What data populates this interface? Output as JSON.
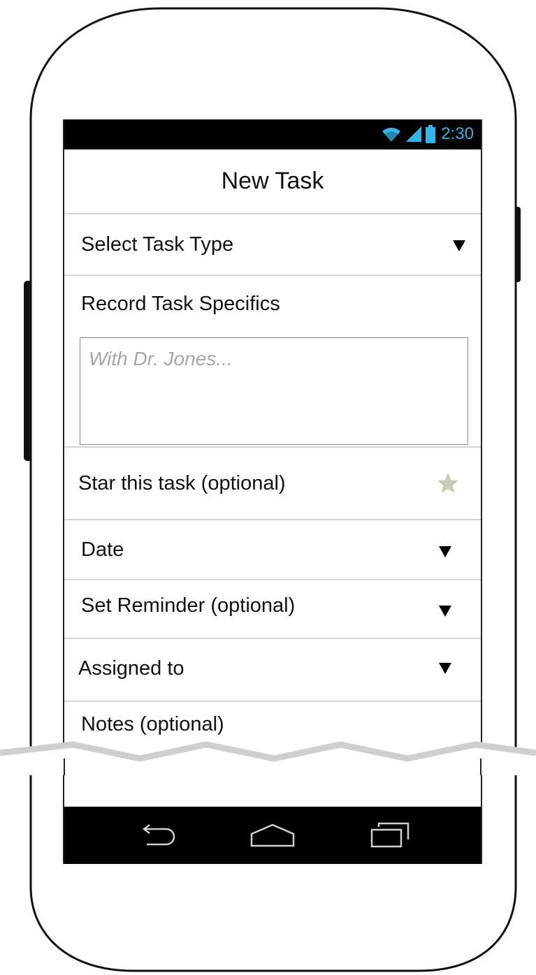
{
  "status_bar": {
    "time": "2:30",
    "icons": [
      "wifi-icon",
      "signal-icon",
      "battery-icon"
    ],
    "time_color": "#33b5e5"
  },
  "header": {
    "title": "New Task"
  },
  "form": {
    "task_type": {
      "label": "Select Task Type",
      "icon": "dropdown-caret-icon"
    },
    "specifics": {
      "label": "Record Task Specifics",
      "placeholder": "With Dr. Jones..."
    },
    "star": {
      "label": "Star this task (optional)",
      "icon": "star-icon",
      "icon_color": "#c9cbb8"
    },
    "date": {
      "label": "Date",
      "icon": "dropdown-caret-icon"
    },
    "reminder": {
      "label": "Set Reminder (optional)",
      "icon": "dropdown-caret-icon"
    },
    "assigned": {
      "label": "Assigned to",
      "icon": "dropdown-caret-icon"
    },
    "notes": {
      "label": "Notes (optional)"
    }
  },
  "nav_bar": {
    "buttons": [
      "back-icon",
      "home-icon",
      "recent-apps-icon"
    ]
  }
}
